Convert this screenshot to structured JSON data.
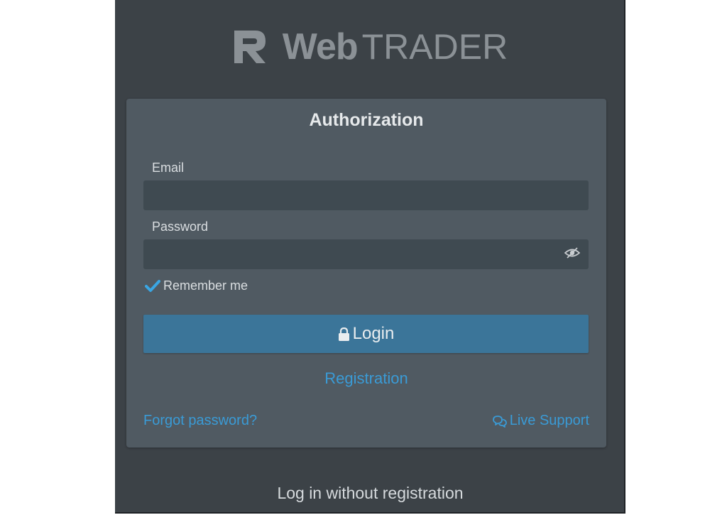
{
  "logo": {
    "web": "Web",
    "trader": "TRADER"
  },
  "auth": {
    "title": "Authorization",
    "email_label": "Email",
    "email_value": "",
    "password_label": "Password",
    "password_value": "",
    "remember_label": "Remember me",
    "remember_checked": true,
    "login_label": "Login",
    "registration_label": "Registration",
    "forgot_label": "Forgot password?",
    "support_label": "Live Support"
  },
  "footer": {
    "no_registration_label": "Log in without registration"
  },
  "icons": {
    "logo": "r-logo-icon",
    "password_toggle": "eye-slash-icon",
    "remember": "checkmark-icon",
    "login": "lock-icon",
    "support": "chat-bubbles-icon"
  },
  "colors": {
    "background": "#3c4247",
    "card": "#505a62",
    "input": "#3f4a51",
    "primary_button": "#3b7599",
    "link": "#3a9bd6",
    "check": "#3aa6e3"
  }
}
